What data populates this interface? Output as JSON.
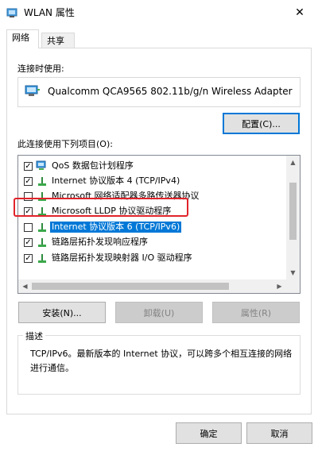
{
  "window": {
    "title": "WLAN 属性",
    "close_glyph": "✕"
  },
  "tabs": [
    {
      "label": "网络",
      "active": true
    },
    {
      "label": "共享",
      "active": false
    }
  ],
  "connect_using_label": "连接时使用:",
  "adapter": {
    "name": "Qualcomm QCA9565 802.11b/g/n Wireless Adapter"
  },
  "configure_button": "配置(C)...",
  "items_label": "此连接使用下列项目(O):",
  "components": [
    {
      "label": "QoS 数据包计划程序",
      "checked": true,
      "selected": false,
      "icon": "qos-network-icon"
    },
    {
      "label": "Internet 协议版本 4 (TCP/IPv4)",
      "checked": true,
      "selected": false,
      "icon": "protocol-icon"
    },
    {
      "label": "Microsoft 网络适配器多路传送器协议",
      "checked": false,
      "selected": false,
      "icon": "protocol-icon"
    },
    {
      "label": "Microsoft LLDP 协议驱动程序",
      "checked": true,
      "selected": false,
      "icon": "protocol-icon"
    },
    {
      "label": "Internet 协议版本 6 (TCP/IPv6)",
      "checked": false,
      "selected": true,
      "icon": "protocol-icon"
    },
    {
      "label": "链路层拓扑发现响应程序",
      "checked": true,
      "selected": false,
      "icon": "protocol-icon"
    },
    {
      "label": "链路层拓扑发现映射器 I/O 驱动程序",
      "checked": true,
      "selected": false,
      "icon": "protocol-icon"
    }
  ],
  "buttons": {
    "install": "安装(N)...",
    "uninstall": "卸载(U)",
    "properties": "属性(R)",
    "ok": "确定",
    "cancel": "取消"
  },
  "description": {
    "title": "描述",
    "text": "TCP/IPv6。最新版本的 Internet 协议，可以跨多个相互连接的网络进行通信。"
  },
  "colors": {
    "selection": "#0078d7",
    "highlight_border": "#e0232a",
    "focus": "#0078d7"
  }
}
